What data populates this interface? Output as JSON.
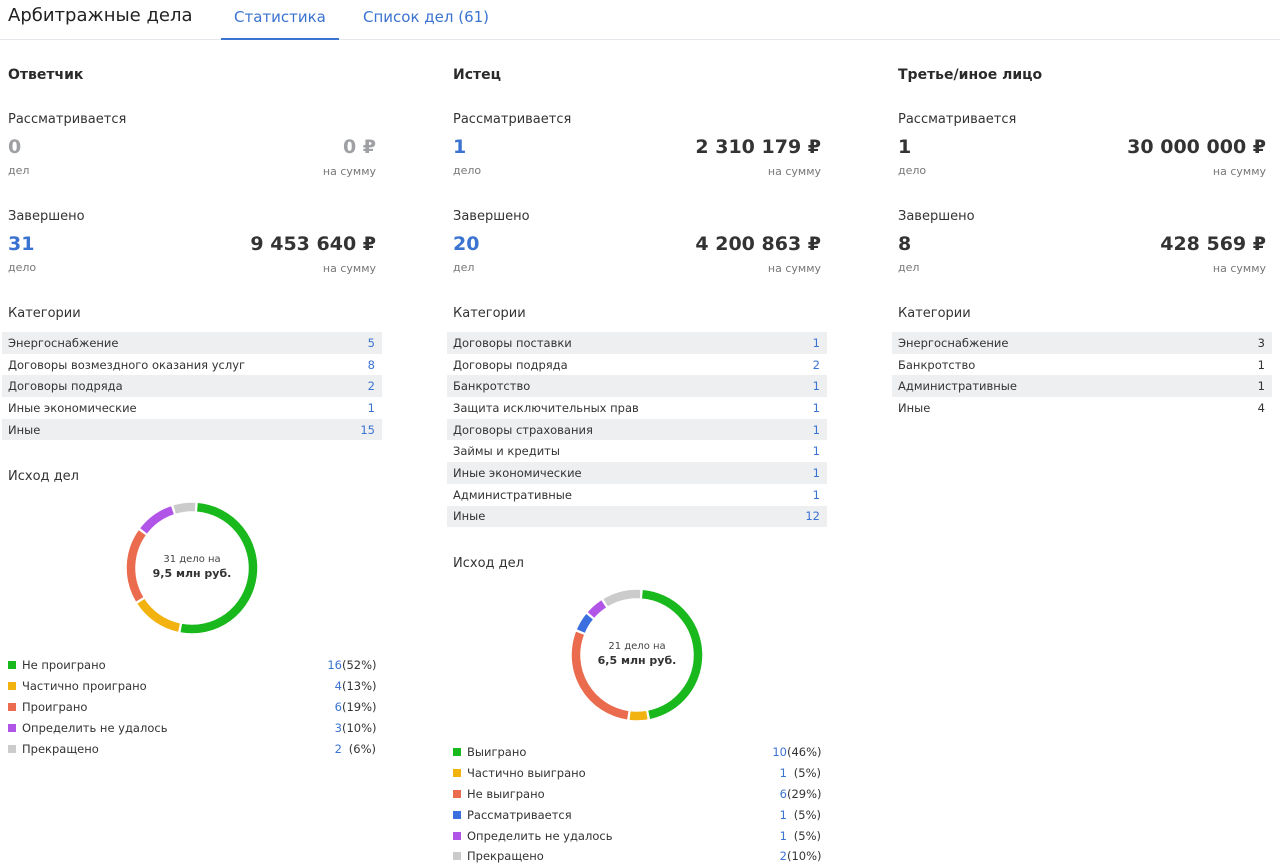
{
  "header": {
    "title": "Арбитражные дела",
    "tabs": [
      {
        "label": "Статистика",
        "active": true
      },
      {
        "label": "Список дел (61)",
        "active": false
      }
    ],
    "accent_color": "#3b73d0"
  },
  "columns": [
    {
      "title": "Ответчик",
      "pending": {
        "label": "Рассматривается",
        "count": "0",
        "count_caption": "дел",
        "sum": "0 ₽",
        "sum_caption": "на сумму"
      },
      "completed": {
        "label": "Завершено",
        "count": "31",
        "count_caption": "дело",
        "sum": "9 453 640 ₽",
        "sum_caption": "на сумму"
      },
      "categories_label": "Категории",
      "categories": [
        {
          "name": "Энергоснабжение",
          "count": "5"
        },
        {
          "name": "Договоры возмездного оказания услуг",
          "count": "8"
        },
        {
          "name": "Договоры подряда",
          "count": "2"
        },
        {
          "name": "Иные экономические",
          "count": "1"
        },
        {
          "name": "Иные",
          "count": "15"
        }
      ],
      "outcome_label": "Исход дел",
      "donut": {
        "line1": "31 дело на",
        "line2": "9,5 млн руб."
      },
      "outcomes": [
        {
          "name": "Не проиграно",
          "count": "16",
          "pct": "(52%)",
          "value": 52,
          "color": "#19b81d"
        },
        {
          "name": "Частично проиграно",
          "count": "4",
          "pct": "(13%)",
          "value": 13,
          "color": "#f2b20f"
        },
        {
          "name": "Проиграно",
          "count": "6",
          "pct": "(19%)",
          "value": 19,
          "color": "#ea6b4d"
        },
        {
          "name": "Определить не удалось",
          "count": "3",
          "pct": "(10%)",
          "value": 10,
          "color": "#b155e8"
        },
        {
          "name": "Прекращено",
          "count": "2",
          "pct": "(6%)",
          "value": 6,
          "color": "#cbcbcb"
        }
      ]
    },
    {
      "title": "Истец",
      "pending": {
        "label": "Рассматривается",
        "count": "1",
        "count_caption": "дело",
        "sum": "2 310 179 ₽",
        "sum_caption": "на сумму"
      },
      "completed": {
        "label": "Завершено",
        "count": "20",
        "count_caption": "дел",
        "sum": "4 200 863 ₽",
        "sum_caption": "на сумму"
      },
      "categories_label": "Категории",
      "categories": [
        {
          "name": "Договоры поставки",
          "count": "1"
        },
        {
          "name": "Договоры подряда",
          "count": "2"
        },
        {
          "name": "Банкротство",
          "count": "1"
        },
        {
          "name": "Защита исключительных прав",
          "count": "1"
        },
        {
          "name": "Договоры страхования",
          "count": "1"
        },
        {
          "name": "Займы и кредиты",
          "count": "1"
        },
        {
          "name": "Иные экономические",
          "count": "1"
        },
        {
          "name": "Административные",
          "count": "1"
        },
        {
          "name": "Иные",
          "count": "12"
        }
      ],
      "outcome_label": "Исход дел",
      "donut": {
        "line1": "21 дело на",
        "line2": "6,5 млн руб."
      },
      "outcomes": [
        {
          "name": "Выиграно",
          "count": "10",
          "pct": "(46%)",
          "value": 46,
          "color": "#19b81d"
        },
        {
          "name": "Частично выиграно",
          "count": "1",
          "pct": "(5%)",
          "value": 5,
          "color": "#f2b20f"
        },
        {
          "name": "Не выиграно",
          "count": "6",
          "pct": "(29%)",
          "value": 29,
          "color": "#ea6b4d"
        },
        {
          "name": "Рассматривается",
          "count": "1",
          "pct": "(5%)",
          "value": 5,
          "color": "#3b6fe0"
        },
        {
          "name": "Определить не удалось",
          "count": "1",
          "pct": "(5%)",
          "value": 5,
          "color": "#b155e8"
        },
        {
          "name": "Прекращено",
          "count": "2",
          "pct": "(10%)",
          "value": 10,
          "color": "#cbcbcb"
        }
      ]
    },
    {
      "title": "Третье/иное лицо",
      "pending": {
        "label": "Рассматривается",
        "count": "1",
        "count_caption": "дело",
        "sum": "30 000 000 ₽",
        "sum_caption": "на сумму"
      },
      "completed": {
        "label": "Завершено",
        "count": "8",
        "count_caption": "дел",
        "sum": "428 569 ₽",
        "sum_caption": "на сумму"
      },
      "categories_label": "Категории",
      "categories": [
        {
          "name": "Энергоснабжение",
          "count": "3"
        },
        {
          "name": "Банкротство",
          "count": "1"
        },
        {
          "name": "Административные",
          "count": "1"
        },
        {
          "name": "Иные",
          "count": "4"
        }
      ]
    }
  ]
}
